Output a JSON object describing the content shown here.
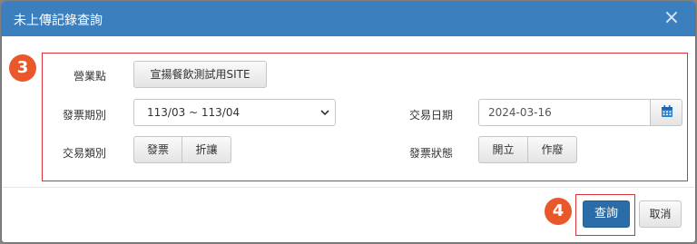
{
  "dialog": {
    "title": "未上傳記錄查詢",
    "close_icon": "×"
  },
  "markers": {
    "form": "3",
    "submit": "4"
  },
  "form": {
    "store_label": "營業點",
    "store_value": "宣揚餐飲測試用SITE",
    "period_label": "發票期別",
    "period_value": "113/03 ~ 113/04",
    "date_label": "交易日期",
    "date_value": "2024-03-16",
    "type_label": "交易類別",
    "type_options": [
      "發票",
      "折讓"
    ],
    "status_label": "發票狀態",
    "status_options": [
      "開立",
      "作廢"
    ]
  },
  "footer": {
    "query_label": "查詢",
    "cancel_label": "取消"
  },
  "colors": {
    "titlebar": "#3b7fbf",
    "primary": "#2a6ca8",
    "marker": "#e8582a",
    "highlight": "#d9333a",
    "calendar_icon": "#2f7fcf"
  }
}
